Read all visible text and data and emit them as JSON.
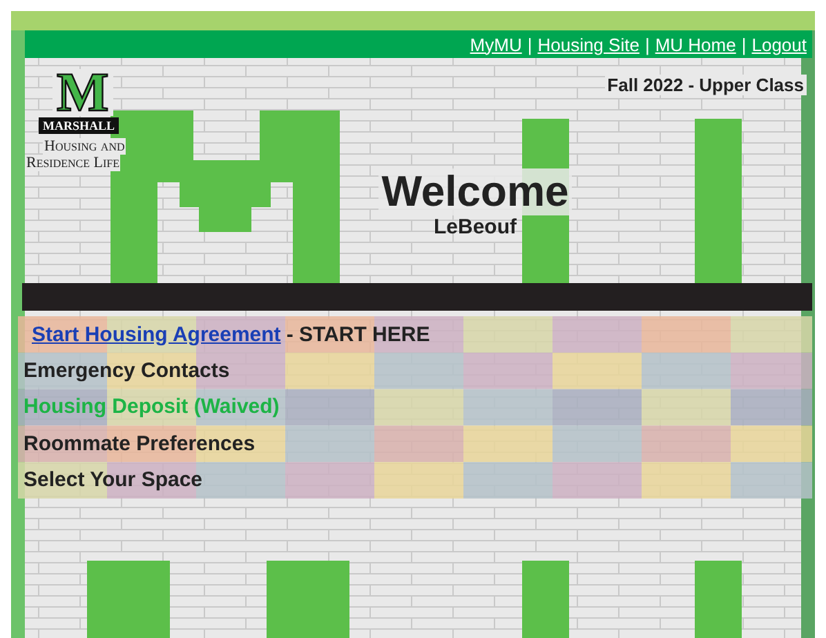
{
  "top_links": [
    {
      "label": "MyMU"
    },
    {
      "label": "Housing Site"
    },
    {
      "label": "MU Home"
    },
    {
      "label": "Logout"
    }
  ],
  "link_separator": "|",
  "logo": {
    "letter": "M",
    "name": "MARSHALL",
    "line_1": "Housing and",
    "line_2": "Residence Life"
  },
  "term": "Fall 2022 - Upper Class",
  "welcome": {
    "title": "Welcome",
    "name": "LeBeouf"
  },
  "menu": [
    {
      "kind": "link",
      "label": "Start Housing Agreement",
      "suffix": "- START HERE"
    },
    {
      "kind": "step",
      "label": "Emergency Contacts",
      "completed": false
    },
    {
      "kind": "step",
      "label": "Housing Deposit (Waived)",
      "completed": true
    },
    {
      "kind": "step",
      "label": "Roommate Preferences",
      "completed": false
    },
    {
      "kind": "step",
      "label": "Select Your Space",
      "completed": false
    }
  ]
}
